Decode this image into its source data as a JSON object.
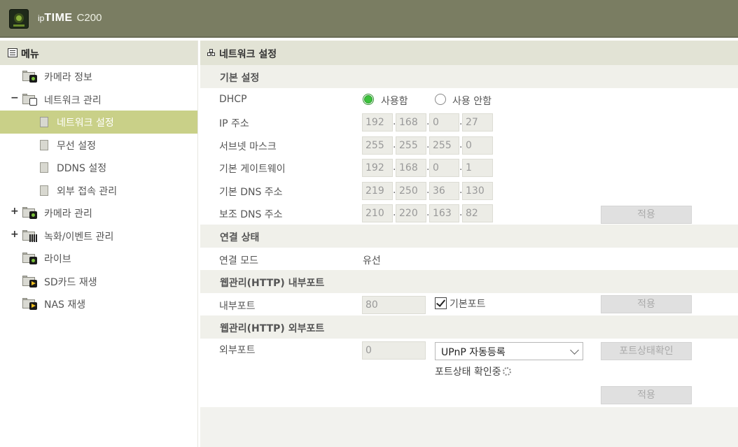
{
  "header": {
    "brand_ip": "ip",
    "brand_time": "TIME",
    "model": "C200"
  },
  "sidebar": {
    "title": "메뉴",
    "items": [
      {
        "label": "카메라 정보"
      },
      {
        "label": "네트워크 관리",
        "toggle": "−"
      },
      {
        "label": "네트워크 설정"
      },
      {
        "label": "무선 설정"
      },
      {
        "label": "DDNS 설정"
      },
      {
        "label": "외부 접속 관리"
      },
      {
        "label": "카메라 관리",
        "toggle": "+"
      },
      {
        "label": "녹화/이벤트 관리",
        "toggle": "+"
      },
      {
        "label": "라이브"
      },
      {
        "label": "SD카드 재생"
      },
      {
        "label": "NAS 재생"
      }
    ]
  },
  "main": {
    "title": "네트워크 설정",
    "basic": {
      "section": "기본 설정",
      "dhcp_label": "DHCP",
      "dhcp_on": "사용함",
      "dhcp_off": "사용 안함",
      "ip_label": "IP 주소",
      "ip": [
        "192",
        "168",
        "0",
        "27"
      ],
      "mask_label": "서브넷 마스크",
      "mask": [
        "255",
        "255",
        "255",
        "0"
      ],
      "gw_label": "기본 게이트웨이",
      "gw": [
        "192",
        "168",
        "0",
        "1"
      ],
      "dns1_label": "기본 DNS 주소",
      "dns1": [
        "219",
        "250",
        "36",
        "130"
      ],
      "dns2_label": "보조 DNS 주소",
      "dns2": [
        "210",
        "220",
        "163",
        "82"
      ],
      "apply": "적용"
    },
    "status": {
      "section": "연결 상태",
      "mode_label": "연결 모드",
      "mode_value": "유선"
    },
    "internal": {
      "section": "웹관리(HTTP) 내부포트",
      "port_label": "내부포트",
      "port_value": "80",
      "default_port_label": "기본포트",
      "apply": "적용"
    },
    "external": {
      "section": "웹관리(HTTP) 외부포트",
      "port_label": "외부포트",
      "port_value": "0",
      "upnp_selected": "UPnP 자동등록",
      "check_button": "포트상태확인",
      "checking_text": "포트상태 확인중",
      "apply": "적용"
    }
  }
}
